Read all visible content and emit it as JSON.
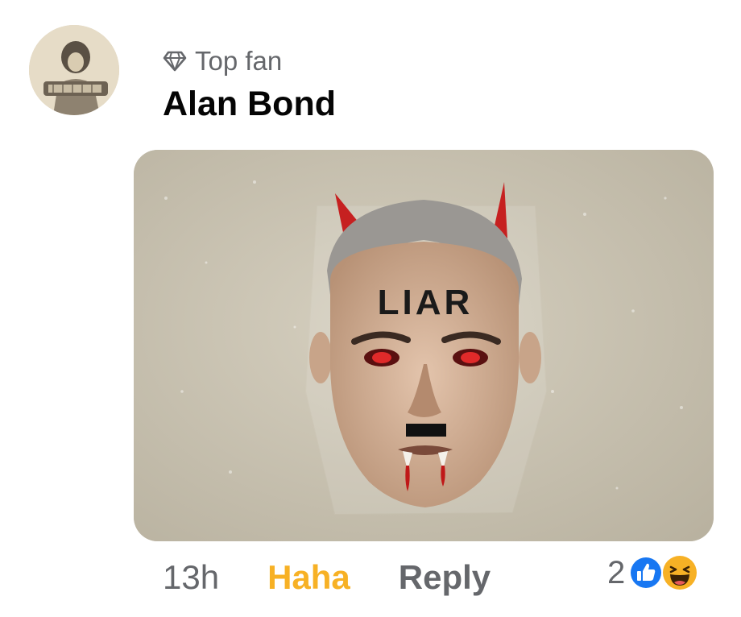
{
  "comment": {
    "badge": {
      "icon": "diamond-icon",
      "label": "Top fan"
    },
    "author": "Alan Bond",
    "image": {
      "forehead_text": "LIAR"
    },
    "actions": {
      "time": "13h",
      "reaction_label": "Haha",
      "reaction_color": "#f7b125",
      "reply_label": "Reply"
    },
    "reactions": {
      "count": "2",
      "icons": [
        "like-icon",
        "haha-icon"
      ],
      "like_color": "#1877f2",
      "haha_color": "#f7b125"
    }
  }
}
